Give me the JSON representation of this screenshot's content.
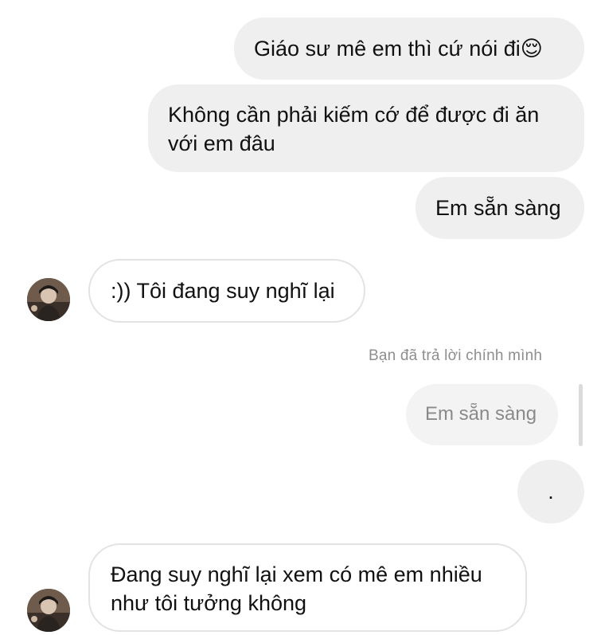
{
  "conversation": {
    "messages": [
      {
        "direction": "sent",
        "text": "Giáo sư mê em thì cứ nói đi😌"
      },
      {
        "direction": "sent",
        "text": "Không cần phải kiếm cớ để được đi ăn với em đâu"
      },
      {
        "direction": "sent",
        "text": "Em sẵn sàng"
      },
      {
        "direction": "received",
        "text": ":)) Tôi đang suy nghĩ lại"
      },
      {
        "direction": "sent",
        "text": "."
      },
      {
        "direction": "received",
        "text": "Đang suy nghĩ lại xem có mê em nhiều như tôi tưởng không"
      }
    ],
    "reply": {
      "label": "Bạn đã trả lời chính mình",
      "quoted_text": "Em sẵn sàng"
    }
  },
  "colors": {
    "sent_bubble": "#efefef",
    "received_bubble_border": "#e3e3e3",
    "meta_text": "#8e8e8e"
  }
}
